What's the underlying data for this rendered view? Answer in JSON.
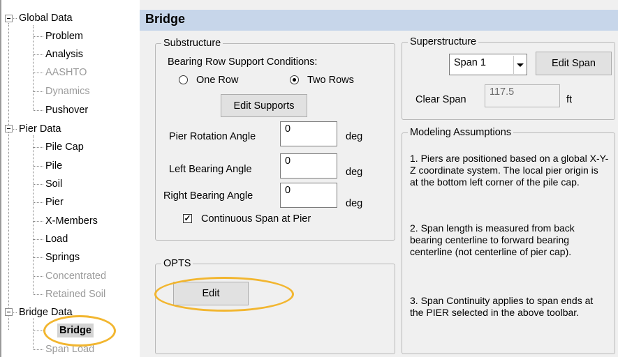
{
  "tree": {
    "global_data": "Global Data",
    "global_children": [
      {
        "label": "Problem",
        "disabled": false
      },
      {
        "label": "Analysis",
        "disabled": false
      },
      {
        "label": "AASHTO",
        "disabled": true
      },
      {
        "label": "Dynamics",
        "disabled": true
      },
      {
        "label": "Pushover",
        "disabled": false
      }
    ],
    "pier_data": "Pier Data",
    "pier_children": [
      {
        "label": "Pile Cap",
        "disabled": false
      },
      {
        "label": "Pile",
        "disabled": false
      },
      {
        "label": "Soil",
        "disabled": false
      },
      {
        "label": "Pier",
        "disabled": false
      },
      {
        "label": "X-Members",
        "disabled": false
      },
      {
        "label": "Load",
        "disabled": false
      },
      {
        "label": "Springs",
        "disabled": false
      },
      {
        "label": "Concentrated",
        "disabled": true
      },
      {
        "label": "Retained Soil",
        "disabled": true
      }
    ],
    "bridge_data": "Bridge Data",
    "bridge_children": [
      {
        "label": "Bridge",
        "disabled": false,
        "selected": true
      },
      {
        "label": "Span Load",
        "disabled": true
      }
    ]
  },
  "panel": {
    "title": "Bridge",
    "substructure": {
      "legend": "Substructure",
      "bearing_label": "Bearing Row Support Conditions:",
      "radio_one": "One Row",
      "radio_two": "Two Rows",
      "selected": "Two Rows",
      "edit_supports": "Edit Supports",
      "pier_rotation_label": "Pier Rotation Angle",
      "pier_rotation_value": "0",
      "left_bearing_label": "Left Bearing Angle",
      "left_bearing_value": "0",
      "right_bearing_label": "Right Bearing Angle",
      "right_bearing_value": "0",
      "unit_deg": "deg",
      "continuous_label": "Continuous Span at Pier",
      "continuous_checked": true,
      "check_mark": "✓"
    },
    "opts": {
      "legend": "OPTS",
      "edit": "Edit"
    },
    "superstructure": {
      "legend": "Superstructure",
      "span_selected": "Span 1",
      "edit_span": "Edit Span",
      "clear_span_label": "Clear Span",
      "clear_span_value": "117.5",
      "clear_span_unit": "ft"
    },
    "modeling": {
      "legend": "Modeling Assumptions",
      "note1": "1. Piers are positioned based on a global X-Y-Z coordinate system. The local pier origin is at the bottom left corner of the pile cap.",
      "note2": "2. Span length is measured from back bearing centerline to forward bearing centerline (not centerline of pier cap).",
      "note3": "3. Span Continuity applies to span ends at the PIER selected in the above toolbar."
    }
  },
  "highlight_color": "#f2b630"
}
